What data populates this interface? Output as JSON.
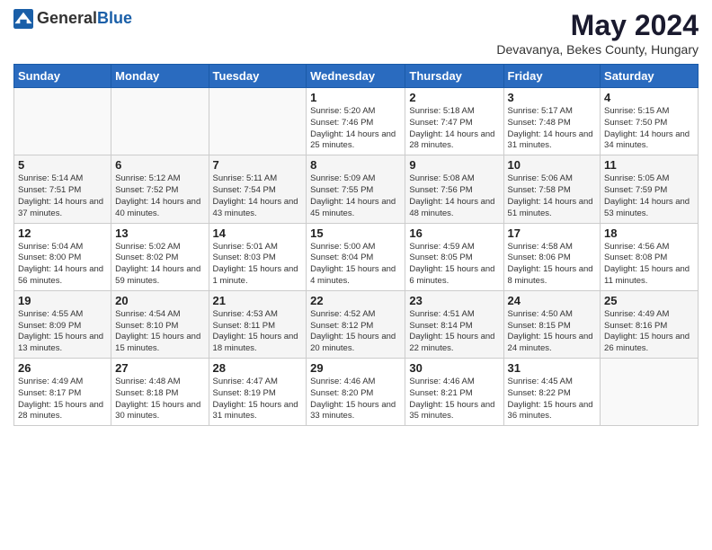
{
  "header": {
    "logo_general": "General",
    "logo_blue": "Blue",
    "main_title": "May 2024",
    "subtitle": "Devavanya, Bekes County, Hungary"
  },
  "days_of_week": [
    "Sunday",
    "Monday",
    "Tuesday",
    "Wednesday",
    "Thursday",
    "Friday",
    "Saturday"
  ],
  "weeks": [
    [
      {
        "day": "",
        "info": ""
      },
      {
        "day": "",
        "info": ""
      },
      {
        "day": "",
        "info": ""
      },
      {
        "day": "1",
        "info": "Sunrise: 5:20 AM\nSunset: 7:46 PM\nDaylight: 14 hours\nand 25 minutes."
      },
      {
        "day": "2",
        "info": "Sunrise: 5:18 AM\nSunset: 7:47 PM\nDaylight: 14 hours\nand 28 minutes."
      },
      {
        "day": "3",
        "info": "Sunrise: 5:17 AM\nSunset: 7:48 PM\nDaylight: 14 hours\nand 31 minutes."
      },
      {
        "day": "4",
        "info": "Sunrise: 5:15 AM\nSunset: 7:50 PM\nDaylight: 14 hours\nand 34 minutes."
      }
    ],
    [
      {
        "day": "5",
        "info": "Sunrise: 5:14 AM\nSunset: 7:51 PM\nDaylight: 14 hours\nand 37 minutes."
      },
      {
        "day": "6",
        "info": "Sunrise: 5:12 AM\nSunset: 7:52 PM\nDaylight: 14 hours\nand 40 minutes."
      },
      {
        "day": "7",
        "info": "Sunrise: 5:11 AM\nSunset: 7:54 PM\nDaylight: 14 hours\nand 43 minutes."
      },
      {
        "day": "8",
        "info": "Sunrise: 5:09 AM\nSunset: 7:55 PM\nDaylight: 14 hours\nand 45 minutes."
      },
      {
        "day": "9",
        "info": "Sunrise: 5:08 AM\nSunset: 7:56 PM\nDaylight: 14 hours\nand 48 minutes."
      },
      {
        "day": "10",
        "info": "Sunrise: 5:06 AM\nSunset: 7:58 PM\nDaylight: 14 hours\nand 51 minutes."
      },
      {
        "day": "11",
        "info": "Sunrise: 5:05 AM\nSunset: 7:59 PM\nDaylight: 14 hours\nand 53 minutes."
      }
    ],
    [
      {
        "day": "12",
        "info": "Sunrise: 5:04 AM\nSunset: 8:00 PM\nDaylight: 14 hours\nand 56 minutes."
      },
      {
        "day": "13",
        "info": "Sunrise: 5:02 AM\nSunset: 8:02 PM\nDaylight: 14 hours\nand 59 minutes."
      },
      {
        "day": "14",
        "info": "Sunrise: 5:01 AM\nSunset: 8:03 PM\nDaylight: 15 hours\nand 1 minute."
      },
      {
        "day": "15",
        "info": "Sunrise: 5:00 AM\nSunset: 8:04 PM\nDaylight: 15 hours\nand 4 minutes."
      },
      {
        "day": "16",
        "info": "Sunrise: 4:59 AM\nSunset: 8:05 PM\nDaylight: 15 hours\nand 6 minutes."
      },
      {
        "day": "17",
        "info": "Sunrise: 4:58 AM\nSunset: 8:06 PM\nDaylight: 15 hours\nand 8 minutes."
      },
      {
        "day": "18",
        "info": "Sunrise: 4:56 AM\nSunset: 8:08 PM\nDaylight: 15 hours\nand 11 minutes."
      }
    ],
    [
      {
        "day": "19",
        "info": "Sunrise: 4:55 AM\nSunset: 8:09 PM\nDaylight: 15 hours\nand 13 minutes."
      },
      {
        "day": "20",
        "info": "Sunrise: 4:54 AM\nSunset: 8:10 PM\nDaylight: 15 hours\nand 15 minutes."
      },
      {
        "day": "21",
        "info": "Sunrise: 4:53 AM\nSunset: 8:11 PM\nDaylight: 15 hours\nand 18 minutes."
      },
      {
        "day": "22",
        "info": "Sunrise: 4:52 AM\nSunset: 8:12 PM\nDaylight: 15 hours\nand 20 minutes."
      },
      {
        "day": "23",
        "info": "Sunrise: 4:51 AM\nSunset: 8:14 PM\nDaylight: 15 hours\nand 22 minutes."
      },
      {
        "day": "24",
        "info": "Sunrise: 4:50 AM\nSunset: 8:15 PM\nDaylight: 15 hours\nand 24 minutes."
      },
      {
        "day": "25",
        "info": "Sunrise: 4:49 AM\nSunset: 8:16 PM\nDaylight: 15 hours\nand 26 minutes."
      }
    ],
    [
      {
        "day": "26",
        "info": "Sunrise: 4:49 AM\nSunset: 8:17 PM\nDaylight: 15 hours\nand 28 minutes."
      },
      {
        "day": "27",
        "info": "Sunrise: 4:48 AM\nSunset: 8:18 PM\nDaylight: 15 hours\nand 30 minutes."
      },
      {
        "day": "28",
        "info": "Sunrise: 4:47 AM\nSunset: 8:19 PM\nDaylight: 15 hours\nand 31 minutes."
      },
      {
        "day": "29",
        "info": "Sunrise: 4:46 AM\nSunset: 8:20 PM\nDaylight: 15 hours\nand 33 minutes."
      },
      {
        "day": "30",
        "info": "Sunrise: 4:46 AM\nSunset: 8:21 PM\nDaylight: 15 hours\nand 35 minutes."
      },
      {
        "day": "31",
        "info": "Sunrise: 4:45 AM\nSunset: 8:22 PM\nDaylight: 15 hours\nand 36 minutes."
      },
      {
        "day": "",
        "info": ""
      }
    ]
  ]
}
